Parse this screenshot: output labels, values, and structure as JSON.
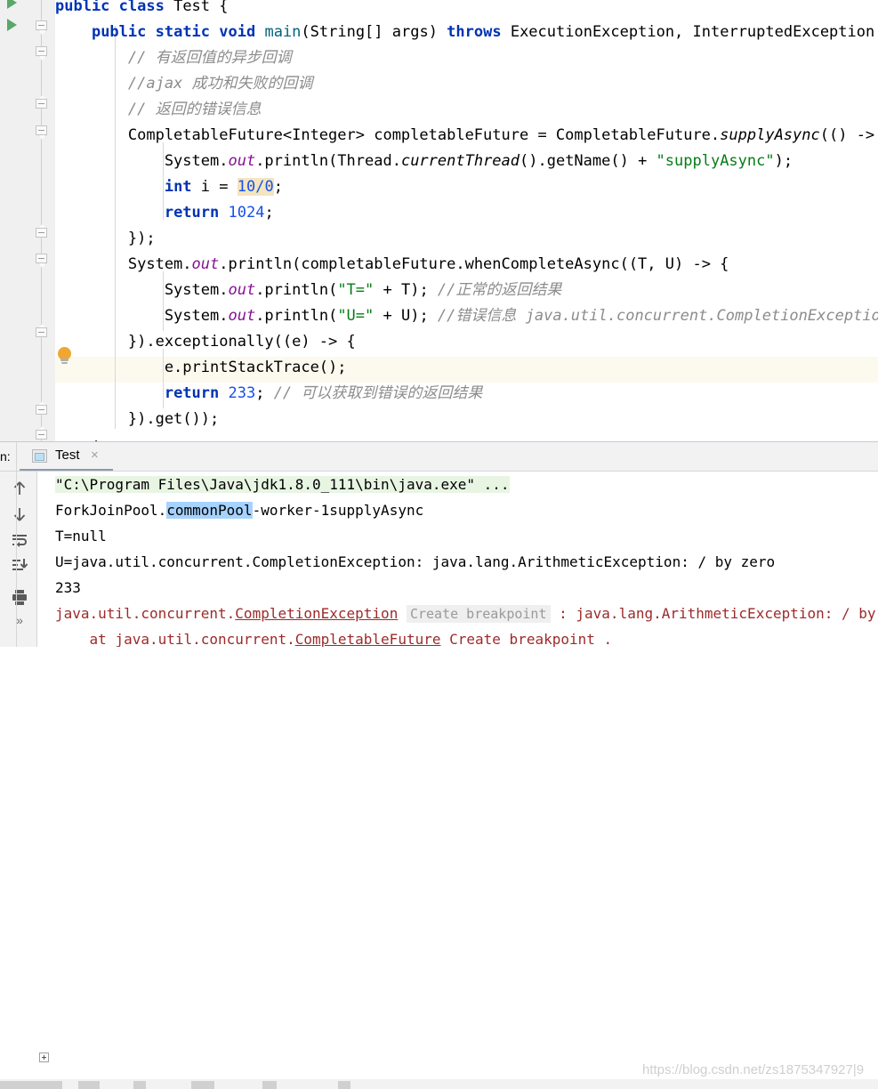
{
  "app": {
    "ide": "IntelliJ IDEA",
    "language": "Java"
  },
  "editor": {
    "lines": [
      {
        "indent": 0,
        "segments": [
          {
            "t": "public ",
            "cls": "k"
          },
          {
            "t": "class ",
            "cls": "k"
          },
          {
            "t": "Test {",
            "cls": "t"
          }
        ]
      },
      {
        "indent": 0,
        "segments": [
          {
            "t": "    ",
            "cls": "t"
          },
          {
            "t": "public ",
            "cls": "k"
          },
          {
            "t": "static ",
            "cls": "k"
          },
          {
            "t": "void ",
            "cls": "k"
          },
          {
            "t": "main",
            "cls": "mm"
          },
          {
            "t": "(String[] args) ",
            "cls": "t"
          },
          {
            "t": "throws ",
            "cls": "k"
          },
          {
            "t": "ExecutionException, InterruptedException {",
            "cls": "t"
          }
        ]
      },
      {
        "indent": 0,
        "segments": [
          {
            "t": "        // 有返回值的异步回调",
            "cls": "c"
          }
        ]
      },
      {
        "indent": 0,
        "segments": [
          {
            "t": "        //ajax 成功和失败的回调",
            "cls": "c"
          }
        ]
      },
      {
        "indent": 0,
        "segments": [
          {
            "t": "        // 返回的错误信息",
            "cls": "c"
          }
        ]
      },
      {
        "indent": 0,
        "segments": [
          {
            "t": "        CompletableFuture<Integer> completableFuture = CompletableFuture.",
            "cls": "t"
          },
          {
            "t": "supplyAsync",
            "cls": "m"
          },
          {
            "t": "(() -> {",
            "cls": "t"
          }
        ]
      },
      {
        "indent": 0,
        "segments": [
          {
            "t": "            System.",
            "cls": "t"
          },
          {
            "t": "out",
            "cls": "f"
          },
          {
            "t": ".println(Thread.",
            "cls": "t"
          },
          {
            "t": "currentThread",
            "cls": "m"
          },
          {
            "t": "().getName() + ",
            "cls": "t"
          },
          {
            "t": "\"supplyAsync\"",
            "cls": "s"
          },
          {
            "t": ");",
            "cls": "t"
          }
        ]
      },
      {
        "indent": 0,
        "segments": [
          {
            "t": "            ",
            "cls": "t"
          },
          {
            "t": "int ",
            "cls": "k"
          },
          {
            "t": "i = ",
            "cls": "t"
          },
          {
            "t": "10/0",
            "cls": "n warn"
          },
          {
            "t": ";",
            "cls": "t"
          }
        ]
      },
      {
        "indent": 0,
        "segments": [
          {
            "t": "            ",
            "cls": "t"
          },
          {
            "t": "return ",
            "cls": "k"
          },
          {
            "t": "1024",
            "cls": "n"
          },
          {
            "t": ";",
            "cls": "t"
          }
        ]
      },
      {
        "indent": 0,
        "segments": [
          {
            "t": "        });",
            "cls": "t"
          }
        ]
      },
      {
        "indent": 0,
        "segments": [
          {
            "t": "        System.",
            "cls": "t"
          },
          {
            "t": "out",
            "cls": "f"
          },
          {
            "t": ".println(completableFuture.whenCompleteAsync((T, U) -> {",
            "cls": "t"
          }
        ]
      },
      {
        "indent": 0,
        "segments": [
          {
            "t": "            System.",
            "cls": "t"
          },
          {
            "t": "out",
            "cls": "f"
          },
          {
            "t": ".println(",
            "cls": "t"
          },
          {
            "t": "\"T=\"",
            "cls": "s"
          },
          {
            "t": " + T); ",
            "cls": "t"
          },
          {
            "t": "//正常的返回结果",
            "cls": "c"
          }
        ]
      },
      {
        "indent": 0,
        "segments": [
          {
            "t": "            System.",
            "cls": "t"
          },
          {
            "t": "out",
            "cls": "f"
          },
          {
            "t": ".println(",
            "cls": "t"
          },
          {
            "t": "\"U=\"",
            "cls": "s"
          },
          {
            "t": " + U); ",
            "cls": "t"
          },
          {
            "t": "//错误信息 java.util.concurrent.CompletionException:",
            "cls": "c"
          }
        ]
      },
      {
        "indent": 0,
        "segments": [
          {
            "t": "        }).exceptionally((e) -> {",
            "cls": "t"
          }
        ]
      },
      {
        "indent": 0,
        "segments": [
          {
            "t": "            e.printStackTrace();",
            "cls": "t"
          }
        ]
      },
      {
        "indent": 0,
        "segments": [
          {
            "t": "            ",
            "cls": "t"
          },
          {
            "t": "return ",
            "cls": "k"
          },
          {
            "t": "233",
            "cls": "n"
          },
          {
            "t": "; ",
            "cls": "t"
          },
          {
            "t": "// 可以获取到错误的返回结果",
            "cls": "c"
          }
        ]
      },
      {
        "indent": 0,
        "segments": [
          {
            "t": "        }).get());",
            "cls": "t"
          }
        ]
      },
      {
        "indent": 0,
        "segments": [
          {
            "t": "    }",
            "cls": "t"
          }
        ]
      }
    ],
    "highlighted_line_index": 14,
    "gutter": {
      "run_markers": [
        "run-class-marker",
        "run-method-marker"
      ],
      "intention_icon": "lightbulb-icon"
    },
    "colors": {
      "keyword": "#0033b3",
      "string": "#067d17",
      "number": "#1750eb",
      "comment": "#8c8c8c",
      "static_field": "#871094",
      "warning_highlight": "#f3e5c0",
      "current_line": "#fcfaef",
      "run_marker_green": "#59a869",
      "bulb_orange": "#f0a732"
    }
  },
  "run_window": {
    "caption": "n:",
    "tab": {
      "label": "Test",
      "close": "×",
      "icon": "run-config-icon"
    },
    "toolbar": [
      {
        "name": "up-arrow-icon",
        "title": "Up"
      },
      {
        "name": "down-arrow-icon",
        "title": "Down"
      },
      {
        "name": "soft-wrap-icon",
        "title": "Soft-Wrap"
      },
      {
        "name": "scroll-to-end-icon",
        "title": "Scroll to End"
      },
      {
        "name": "print-icon",
        "title": "Print"
      },
      {
        "name": "more-icon",
        "title": "»"
      }
    ],
    "console": {
      "lines": [
        {
          "segments": [
            {
              "t": "\"C:\\Program Files\\Java\\jdk1.8.0_111\\bin\\java.exe\" ...",
              "cls": "cmdbg"
            }
          ]
        },
        {
          "segments": [
            {
              "t": "ForkJoinPool.",
              "cls": ""
            },
            {
              "t": "commonPool",
              "cls": "sel"
            },
            {
              "t": "-worker-1supplyAsync",
              "cls": ""
            }
          ]
        },
        {
          "segments": [
            {
              "t": "T=null",
              "cls": ""
            }
          ]
        },
        {
          "segments": [
            {
              "t": "U=java.util.concurrent.CompletionException: java.lang.ArithmeticException: / by zero",
              "cls": ""
            }
          ]
        },
        {
          "segments": [
            {
              "t": "233",
              "cls": ""
            }
          ]
        },
        {
          "segments": [
            {
              "t": "java.util.concurrent.",
              "cls": "err"
            },
            {
              "t": "CompletionException",
              "cls": "errlink"
            },
            {
              "t": " ",
              "cls": ""
            },
            {
              "t": "Create breakpoint",
              "cls": "crumb"
            },
            {
              "t": " : java.lang.ArithmeticException: / by",
              "cls": "err"
            }
          ]
        },
        {
          "segments": [
            {
              "t": "    at java.util.concurrent.",
              "cls": "err"
            },
            {
              "t": "CompletableFuture",
              "cls": "errlink"
            },
            {
              "t": " Create breakpoint .",
              "cls": "err"
            }
          ]
        }
      ],
      "expander_icon": "expand-stacktrace-icon"
    }
  },
  "watermark": "https://blog.csdn.net/zs1875347927|9"
}
